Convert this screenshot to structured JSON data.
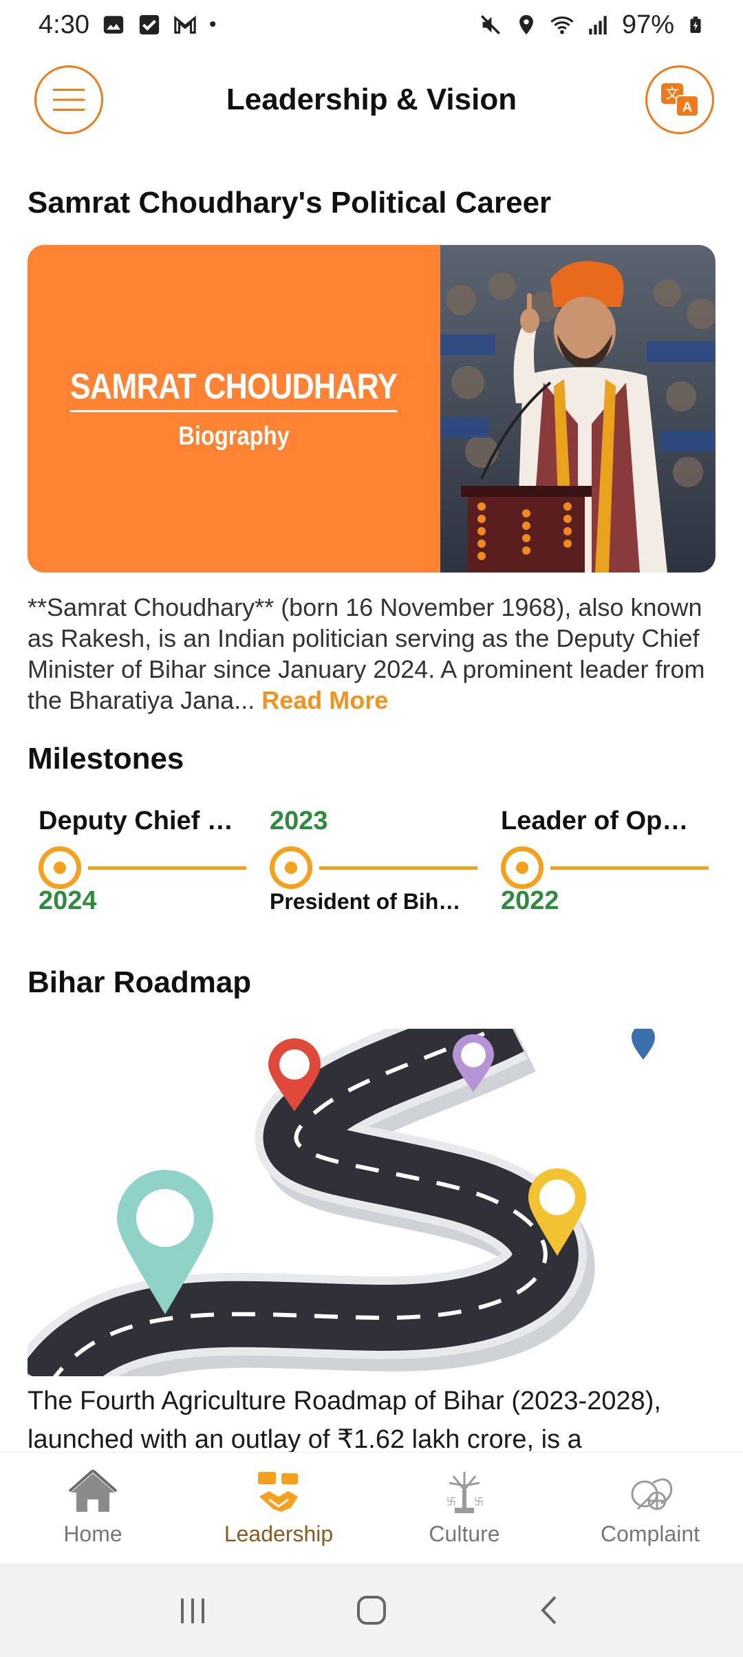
{
  "status_bar": {
    "time": "4:30",
    "battery": "97%",
    "icons_left": [
      "gallery-icon",
      "check-icon",
      "gmail-icon",
      "dot-icon"
    ],
    "icons_right": [
      "mute-icon",
      "location-icon",
      "wifi-icon",
      "signal-icon",
      "battery-icon"
    ]
  },
  "header": {
    "title": "Leadership & Vision"
  },
  "career": {
    "title": "Samrat Choudhary's Political Career",
    "banner_name": "SAMRAT CHOUDHARY",
    "banner_sub": "Biography",
    "bio": "**Samrat Choudhary** (born 16 November 1968), also known as Rakesh, is an Indian politician serving as the Deputy Chief Minister of Bihar since January 2024. A prominent leader from the Bharatiya Jana...",
    "read_more": "Read More"
  },
  "milestones": {
    "title": "Milestones",
    "items": [
      {
        "top": "Deputy Chief Minister of Bihar",
        "bottom": "2024"
      },
      {
        "top": "2023",
        "bottom": "President of Bihar BJP"
      },
      {
        "top": "Leader of Opposition",
        "bottom": "2022"
      }
    ]
  },
  "roadmap": {
    "title": "Bihar Roadmap",
    "text": "The Fourth Agriculture Roadmap of Bihar (2023-2028), launched with an outlay of ₹1.62 lakh crore, is a"
  },
  "bottom_nav": {
    "items": [
      {
        "label": "Home",
        "icon": "home-icon",
        "active": false
      },
      {
        "label": "Leadership",
        "icon": "leadership-icon",
        "active": true
      },
      {
        "label": "Culture",
        "icon": "culture-icon",
        "active": false
      },
      {
        "label": "Complaint",
        "icon": "complaint-icon",
        "active": false
      }
    ]
  },
  "colors": {
    "accent": "#F07A1A",
    "banner": "#FF8333",
    "milestone": "#F5A11E",
    "year": "#2E8B3E",
    "read_more": "#F5921E"
  }
}
